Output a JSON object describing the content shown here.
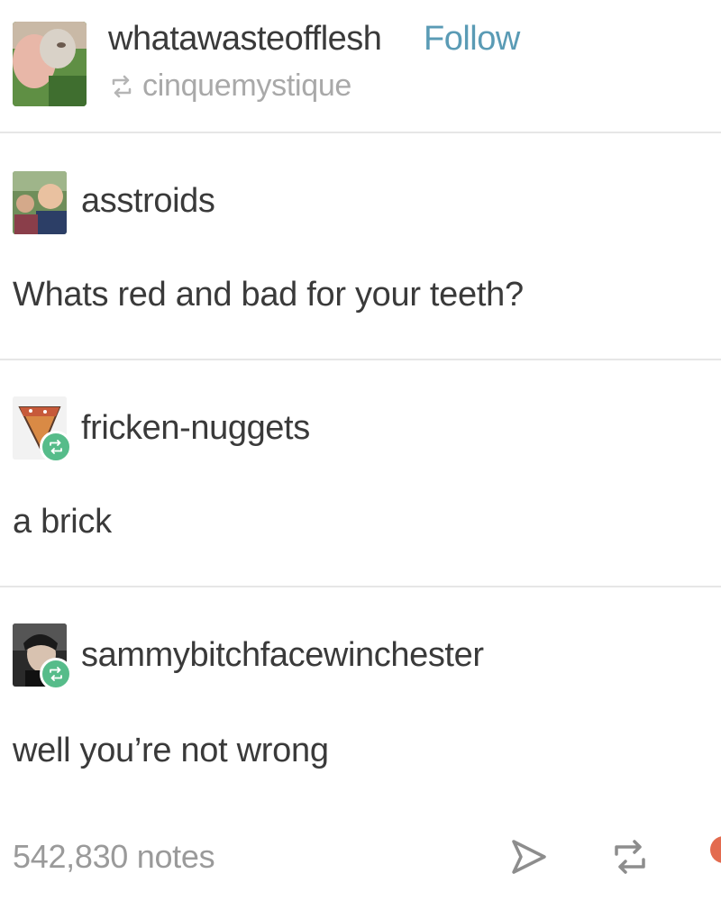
{
  "header": {
    "username": "whatawasteofflesh",
    "follow_label": "Follow",
    "reblogged_from": "cinquemystique"
  },
  "posts": [
    {
      "username": "asstroids",
      "text": "Whats red and bad for your teeth?",
      "reblog_badge": false
    },
    {
      "username": "fricken-nuggets",
      "text": "a brick",
      "reblog_badge": true
    },
    {
      "username": "sammybitchfacewinchester",
      "text": "well you’re not wrong",
      "reblog_badge": true
    }
  ],
  "footer": {
    "notes": "542,830 notes",
    "icons": [
      "share-icon",
      "reblog-icon",
      "like-icon"
    ]
  },
  "colors": {
    "follow": "#5a9bb5",
    "reblog_badge": "#56bc8a",
    "divider": "#e6e6e6",
    "muted": "#a9a9a9"
  }
}
